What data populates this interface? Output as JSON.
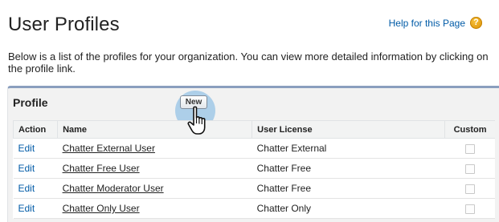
{
  "header": {
    "title": "User Profiles",
    "help_link": "Help for this Page",
    "help_icon": "help-icon",
    "help_icon_glyph": "?"
  },
  "description": "Below is a list of the profiles for your organization. You can view more detailed information by clicking on the profile link.",
  "panel": {
    "title": "Profile",
    "new_button": "New",
    "border_color": "#8a9ebe"
  },
  "table": {
    "columns": [
      "Action",
      "Name",
      "User License",
      "Custom"
    ],
    "rows": [
      {
        "action": "Edit",
        "name": "Chatter External User",
        "license": "Chatter External",
        "custom": false
      },
      {
        "action": "Edit",
        "name": "Chatter Free User",
        "license": "Chatter Free",
        "custom": false
      },
      {
        "action": "Edit",
        "name": "Chatter Moderator User",
        "license": "Chatter Free",
        "custom": false
      },
      {
        "action": "Edit",
        "name": "Chatter Only User",
        "license": "Chatter Only",
        "custom": false
      }
    ]
  },
  "colors": {
    "link": "#015ba7",
    "highlight_halo": "#74b2e2"
  }
}
